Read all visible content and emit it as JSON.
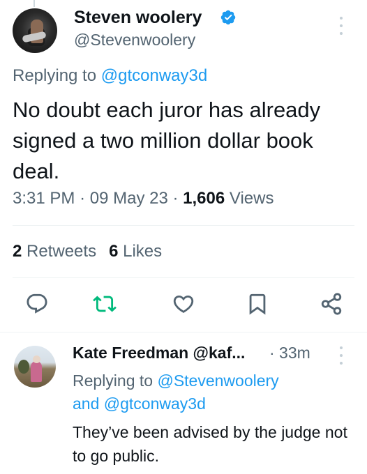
{
  "main_tweet": {
    "author_name": "Steven woolery",
    "author_handle": "@Stevenwoolery",
    "verified": true,
    "replying_prefix": "Replying to ",
    "replying_to": "@gtconway3d",
    "text": "No doubt each juror has already signed a two million dollar book deal.",
    "time": "3:31 PM",
    "separator": "·",
    "date": "09 May 23",
    "views_count": "1,606",
    "views_label": "Views",
    "retweets_count": "2",
    "retweets_label": "Retweets",
    "likes_count": "6",
    "likes_label": "Likes"
  },
  "reply": {
    "author_name": "Kate Freedman @kaf...",
    "time": "· 33m",
    "replying_prefix": "Replying to ",
    "replying_to_1": "@Stevenwoolery",
    "replying_and": "and ",
    "replying_to_2": "@gtconway3d",
    "text": "They’ve been advised by the judge not to go public."
  },
  "actions": [
    "reply-icon",
    "retweet-icon",
    "like-icon",
    "bookmark-icon",
    "share-icon"
  ],
  "colors": {
    "link": "#1d9bf0",
    "retweet": "#00ba7c",
    "secondary_text": "#536471",
    "icon": "#536471"
  }
}
